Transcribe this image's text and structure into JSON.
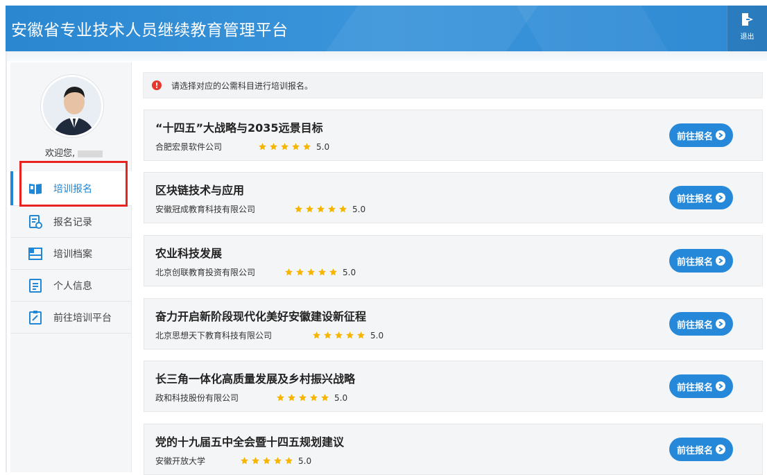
{
  "header": {
    "title": "安徽省专业技术人员继续教育管理平台",
    "logout_label": "退出"
  },
  "sidebar": {
    "welcome": "欢迎您,",
    "items": [
      {
        "label": "培训报名",
        "icon": "book-icon",
        "active": true
      },
      {
        "label": "报名记录",
        "icon": "record-icon",
        "active": false
      },
      {
        "label": "培训档案",
        "icon": "archive-icon",
        "active": false
      },
      {
        "label": "个人信息",
        "icon": "profile-icon",
        "active": false
      },
      {
        "label": "前往培训平台",
        "icon": "platform-icon",
        "active": false
      }
    ]
  },
  "alert": {
    "text": "请选择对应的公需科目进行培训报名。"
  },
  "courses": [
    {
      "title": "“十四五”大战略与2035远景目标",
      "provider": "合肥宏景软件公司",
      "rating": "5.0",
      "stars": 5,
      "button": "前往报名"
    },
    {
      "title": "区块链技术与应用",
      "provider": "安徽冠成教育科技有限公司",
      "rating": "5.0",
      "stars": 5,
      "button": "前往报名"
    },
    {
      "title": "农业科技发展",
      "provider": "北京创联教育投资有限公司",
      "rating": "5.0",
      "stars": 5,
      "button": "前往报名"
    },
    {
      "title": "奋力开启新阶段现代化美好安徽建设新征程",
      "provider": "北京思想天下教育科技有限公司",
      "rating": "5.0",
      "stars": 5,
      "button": "前往报名"
    },
    {
      "title": "长三角一体化高质量发展及乡村振兴战略",
      "provider": "政和科技股份有限公司",
      "rating": "5.0",
      "stars": 5,
      "button": "前往报名"
    },
    {
      "title": "党的十九届五中全会暨十四五规划建议",
      "provider": "安徽开放大学",
      "rating": "5.0",
      "stars": 5,
      "button": "前往报名"
    }
  ],
  "colors": {
    "accent": "#2588d8",
    "star": "#f5b400",
    "highlight": "#e8231f"
  }
}
